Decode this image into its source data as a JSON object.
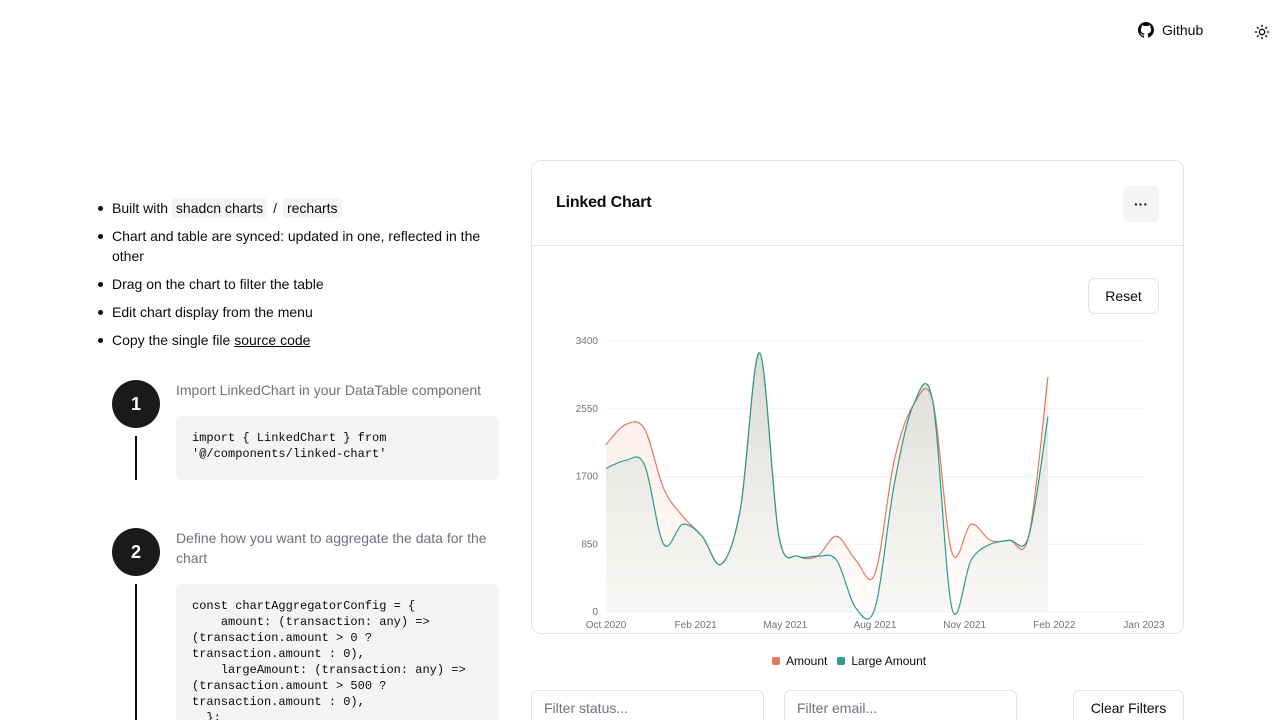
{
  "header": {
    "github_label": "Github",
    "github_icon": "github-icon",
    "theme_icon": "sun-icon"
  },
  "features": {
    "built_with_prefix": "Built with",
    "lib1": "shadcn charts",
    "sep": "/",
    "lib2": "recharts",
    "synced": "Chart and table are synced: updated in one, reflected in the other",
    "drag": "Drag on the chart to filter the table",
    "edit": "Edit chart display from the menu",
    "copy_prefix": "Copy the single file",
    "copy_link": "source code"
  },
  "steps": [
    {
      "number": "1",
      "title": "Import LinkedChart in your DataTable component",
      "code": "import { LinkedChart } from\n'@/components/linked-chart'"
    },
    {
      "number": "2",
      "title": "Define how you want to aggregate the data for the chart",
      "code": "const chartAggregatorConfig = {\n    amount: (transaction: any) =>\n(transaction.amount > 0 ?\ntransaction.amount : 0),\n    largeAmount: (transaction: any) =>\n(transaction.amount > 500 ?\ntransaction.amount : 0),\n  };"
    }
  ],
  "card": {
    "title": "Linked Chart",
    "menu_label": "···",
    "reset_label": "Reset"
  },
  "colors": {
    "amount": "#e07a5f",
    "large_amount": "#2a9d8f"
  },
  "chart_data": {
    "type": "area",
    "title": "Linked Chart",
    "xlabel": "",
    "ylabel": "",
    "x_start": "2020-10",
    "x_end": "2023-02",
    "x_ticks": [
      "Oct 2020",
      "Feb 2021",
      "May 2021",
      "Aug 2021",
      "Nov 2021",
      "Feb 2022",
      "Jan 2023"
    ],
    "ylim": [
      0,
      3400
    ],
    "y_ticks": [
      0,
      850,
      1700,
      2550,
      3400
    ],
    "grid": true,
    "legend": "bottom-center",
    "series": [
      {
        "name": "Amount",
        "color": "#e07a5f",
        "points": [
          [
            "2020-10",
            2100
          ],
          [
            "2020-11",
            2350
          ],
          [
            "2020-12",
            2300
          ],
          [
            "2021-01",
            1550
          ],
          [
            "2021-02",
            1200
          ],
          [
            "2021-03",
            950
          ],
          [
            "2021-04",
            600
          ],
          [
            "2021-05",
            1300
          ],
          [
            "2021-06",
            3250
          ],
          [
            "2021-07",
            950
          ],
          [
            "2021-08",
            700
          ],
          [
            "2021-09",
            700
          ],
          [
            "2021-10",
            950
          ],
          [
            "2021-11",
            650
          ],
          [
            "2021-12",
            480
          ],
          [
            "2022-01",
            1900
          ],
          [
            "2022-02",
            2600
          ],
          [
            "2022-03",
            2650
          ],
          [
            "2022-04",
            750
          ],
          [
            "2022-05",
            1100
          ],
          [
            "2022-06",
            900
          ],
          [
            "2022-07",
            900
          ],
          [
            "2022-08",
            950
          ],
          [
            "2022-09",
            2950
          ]
        ]
      },
      {
        "name": "Large Amount",
        "color": "#2a9d8f",
        "points": [
          [
            "2020-10",
            1800
          ],
          [
            "2020-11",
            1900
          ],
          [
            "2020-12",
            1850
          ],
          [
            "2021-01",
            850
          ],
          [
            "2021-02",
            1100
          ],
          [
            "2021-03",
            950
          ],
          [
            "2021-04",
            600
          ],
          [
            "2021-05",
            1300
          ],
          [
            "2021-06",
            3250
          ],
          [
            "2021-07",
            950
          ],
          [
            "2021-08",
            700
          ],
          [
            "2021-09",
            700
          ],
          [
            "2021-10",
            650
          ],
          [
            "2021-11",
            50
          ],
          [
            "2021-12",
            50
          ],
          [
            "2022-01",
            1600
          ],
          [
            "2022-02",
            2600
          ],
          [
            "2022-03",
            2650
          ],
          [
            "2022-04",
            50
          ],
          [
            "2022-05",
            650
          ],
          [
            "2022-06",
            850
          ],
          [
            "2022-07",
            900
          ],
          [
            "2022-08",
            950
          ],
          [
            "2022-09",
            2450
          ]
        ]
      }
    ]
  },
  "legend": {
    "amount": "Amount",
    "large_amount": "Large Amount"
  },
  "filters": {
    "status_placeholder": "Filter status...",
    "email_placeholder": "Filter email...",
    "clear_label": "Clear Filters"
  }
}
